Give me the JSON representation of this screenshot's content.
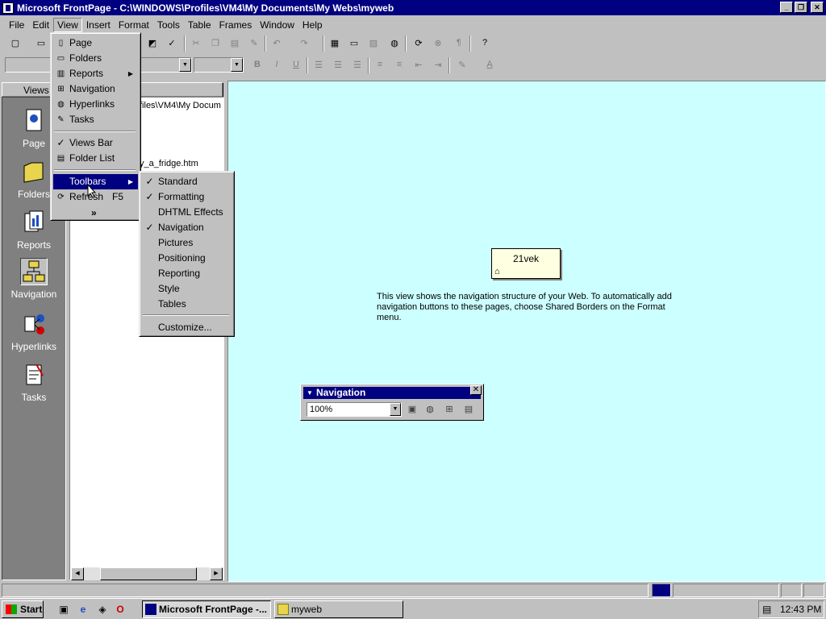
{
  "window": {
    "title": "Microsoft FrontPage - C:\\WINDOWS\\Profiles\\VM4\\My Documents\\My Webs\\myweb"
  },
  "menubar": [
    "File",
    "Edit",
    "View",
    "Insert",
    "Format",
    "Tools",
    "Table",
    "Frames",
    "Window",
    "Help"
  ],
  "views_bar": {
    "header": "Views",
    "items": [
      "Page",
      "Folders",
      "Reports",
      "Navigation",
      "Hyperlinks",
      "Tasks"
    ],
    "selected": "Navigation"
  },
  "folder_list": {
    "path_fragment": "files\\VM4\\My Docum",
    "file_fragment": "y_a_fridge.htm"
  },
  "view_menu": {
    "items": [
      {
        "label": "Page",
        "icon": "page-icon"
      },
      {
        "label": "Folders",
        "icon": "folder-icon"
      },
      {
        "label": "Reports",
        "icon": "reports-icon",
        "submenu": true
      },
      {
        "label": "Navigation",
        "icon": "navigation-icon"
      },
      {
        "label": "Hyperlinks",
        "icon": "hyperlinks-icon"
      },
      {
        "label": "Tasks",
        "icon": "tasks-icon"
      },
      {
        "label": "Views Bar",
        "checked": true
      },
      {
        "label": "Folder List",
        "icon": "folder-list-icon"
      },
      {
        "label": "Toolbars",
        "submenu": true,
        "highlighted": true
      },
      {
        "label": "Refresh",
        "shortcut": "F5",
        "icon": "refresh-icon"
      }
    ],
    "more": "»"
  },
  "toolbars_menu": {
    "items": [
      {
        "label": "Standard",
        "checked": true
      },
      {
        "label": "Formatting",
        "checked": true
      },
      {
        "label": "DHTML Effects",
        "checked": false
      },
      {
        "label": "Navigation",
        "checked": true
      },
      {
        "label": "Pictures",
        "checked": false
      },
      {
        "label": "Positioning",
        "checked": false
      },
      {
        "label": "Reporting",
        "checked": false
      },
      {
        "label": "Style",
        "checked": false
      },
      {
        "label": "Tables",
        "checked": false
      },
      {
        "label": "Customize...",
        "checked": false
      }
    ]
  },
  "navigation_view": {
    "node_label": "21vek",
    "help_text": "This view shows the navigation structure of your Web. To automatically add navigation buttons to these pages, choose Shared Borders on the Format menu."
  },
  "nav_toolbar": {
    "title": "Navigation",
    "zoom": "100%"
  },
  "taskbar": {
    "start": "Start",
    "tasks": [
      "Microsoft FrontPage -...",
      "myweb"
    ],
    "clock": "12:43 PM"
  },
  "colors": {
    "title_bar": "#000080",
    "workspace": "#ccffff",
    "chrome": "#c0c0c0",
    "views_bar": "#808080"
  }
}
